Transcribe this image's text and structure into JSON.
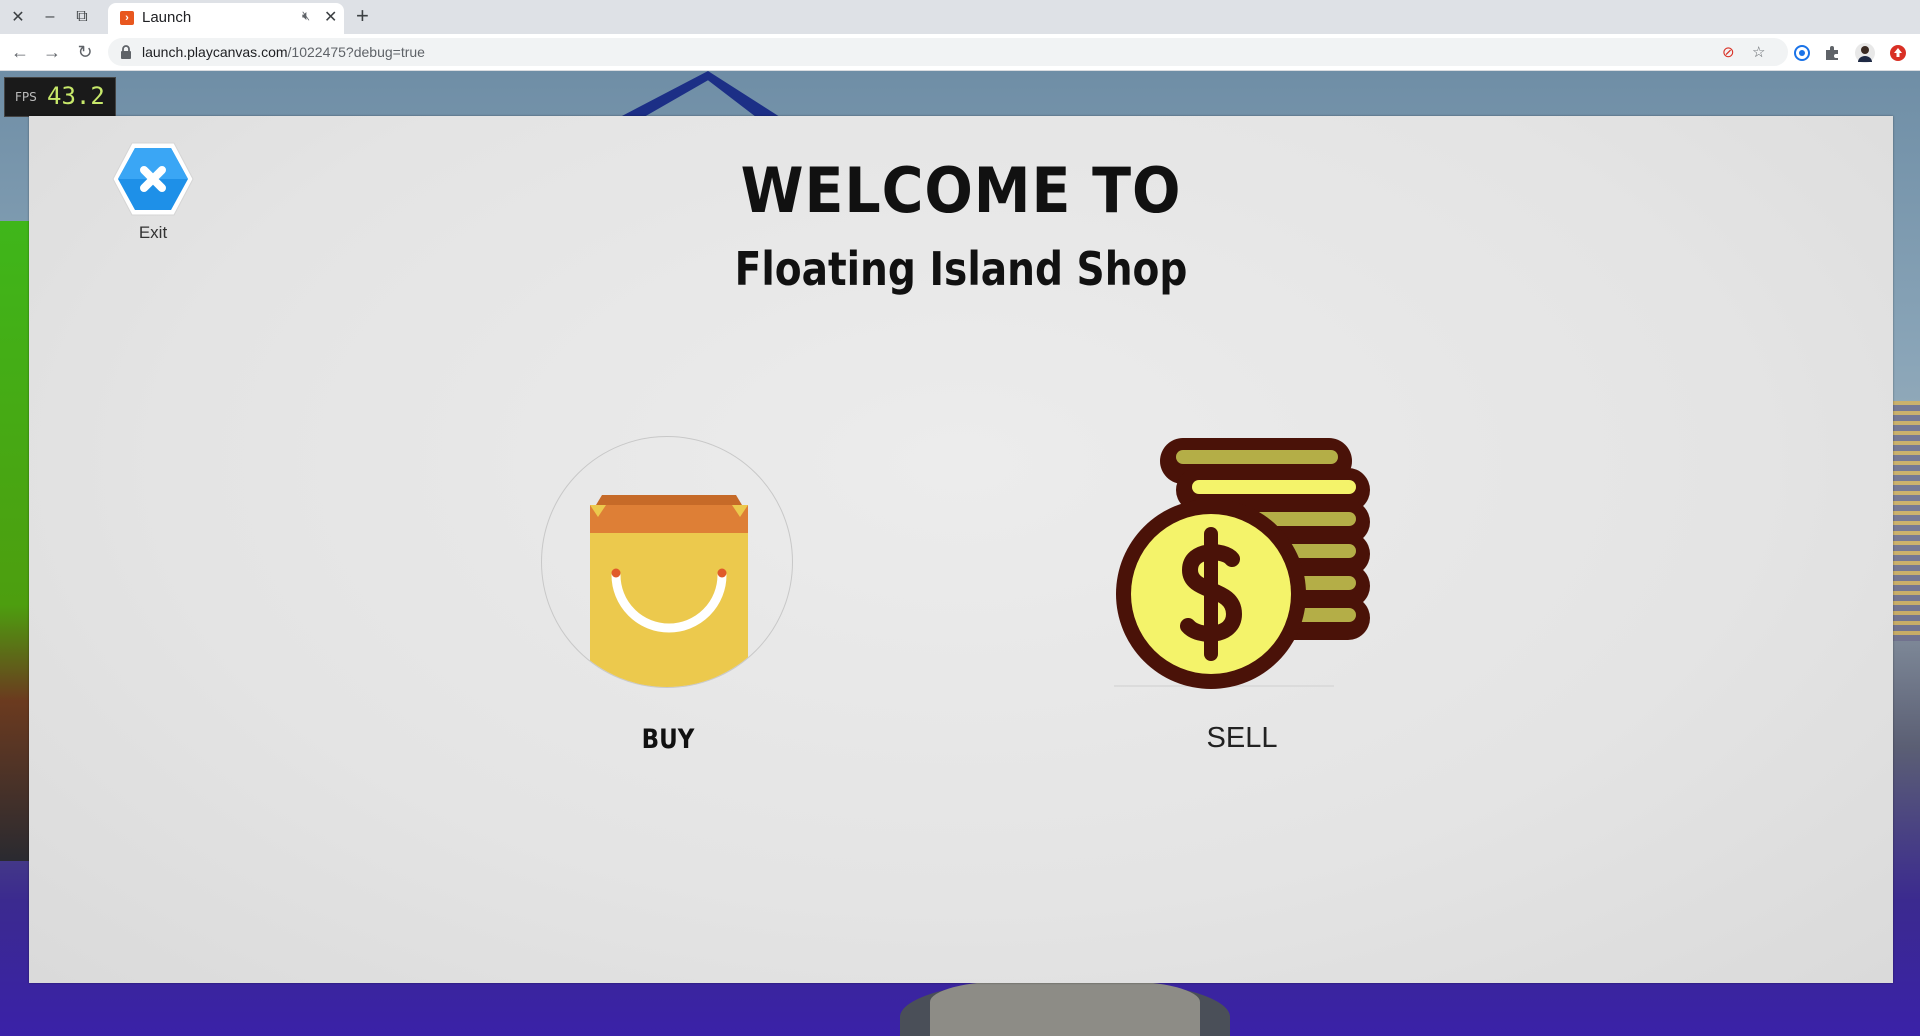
{
  "browser": {
    "tab_title": "Launch",
    "url_host": "launch.playcanvas.com",
    "url_path": "/1022475?debug=true",
    "new_tab_symbol": "+",
    "close_symbol": "✕",
    "icons": [
      "back-arrow-icon",
      "forward-arrow-icon",
      "reload-icon",
      "lock-icon",
      "blocked-popup-icon",
      "star-icon",
      "extension-icon",
      "puzzle-icon",
      "profile-avatar",
      "update-icon"
    ]
  },
  "debug": {
    "fps_label": "FPS",
    "fps_value": "43.2"
  },
  "shop": {
    "title_line1": "WELCOME TO",
    "title_line2": "Floating Island Shop",
    "exit_label": "Exit",
    "buy_label": "BUY",
    "sell_label": "SELL"
  },
  "colors": {
    "exit_blue": "#1e90e8",
    "bag_yellow": "#ecc94d",
    "bag_orange": "#de7f36",
    "coin_dark": "#4a1208",
    "coin_face": "#f4f36a",
    "coin_stack": "#b4ae47"
  }
}
